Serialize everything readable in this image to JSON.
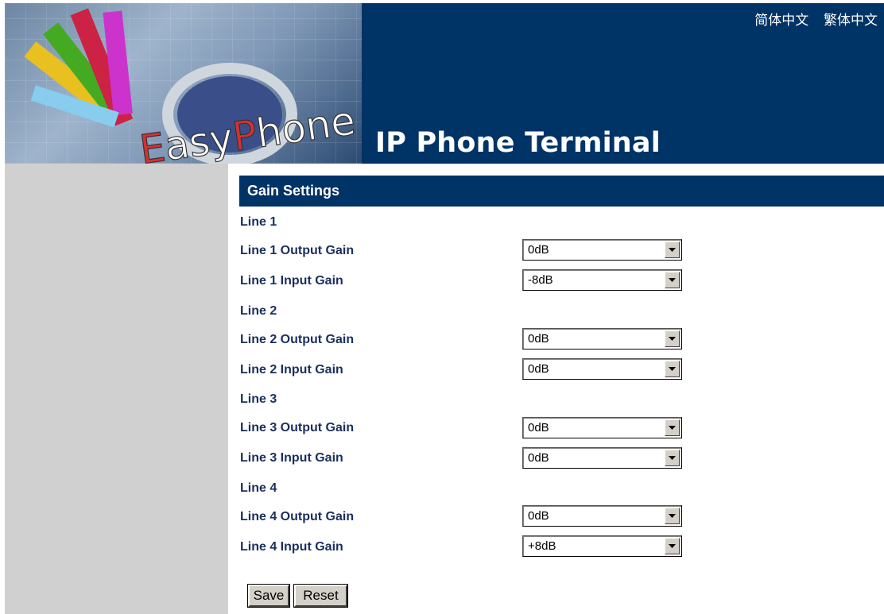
{
  "header": {
    "title": "IP Phone Terminal",
    "logo_text": "EasyPhone",
    "lang_simplified": "简体中文",
    "lang_traditional": "繁体中文"
  },
  "section": {
    "title": "Gain Settings"
  },
  "lines": [
    {
      "heading": "Line 1",
      "output_label": "Line 1 Output Gain",
      "output_value": "0dB",
      "input_label": "Line 1 Input Gain",
      "input_value": "-8dB"
    },
    {
      "heading": "Line 2",
      "output_label": "Line 2 Output Gain",
      "output_value": "0dB",
      "input_label": "Line 2 Input Gain",
      "input_value": "0dB"
    },
    {
      "heading": "Line 3",
      "output_label": "Line 3 Output Gain",
      "output_value": "0dB",
      "input_label": "Line 3 Input Gain",
      "input_value": "0dB"
    },
    {
      "heading": "Line 4",
      "output_label": "Line 4 Output Gain",
      "output_value": "0dB",
      "input_label": "Line 4 Input Gain",
      "input_value": "+8dB"
    }
  ],
  "buttons": {
    "save": "Save",
    "reset": "Reset"
  },
  "colors": {
    "header_bg": "#003366",
    "sidebar_bg": "#d0d0d0",
    "label_text": "#1a2f5e"
  }
}
